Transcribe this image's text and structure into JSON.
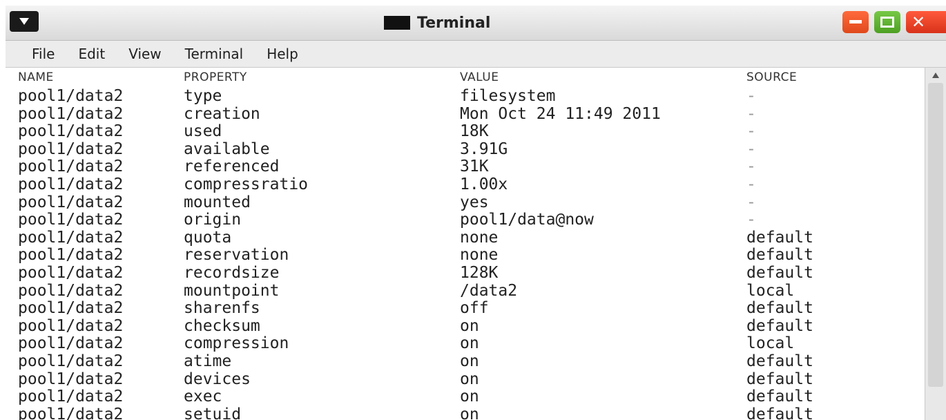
{
  "window": {
    "title": "Terminal"
  },
  "menu": [
    "File",
    "Edit",
    "View",
    "Terminal",
    "Help"
  ],
  "header": {
    "name": "NAME",
    "property": "PROPERTY",
    "value": "VALUE",
    "source": "SOURCE"
  },
  "rows": [
    {
      "name": "pool1/data2",
      "property": "type",
      "value": "filesystem",
      "source": "-"
    },
    {
      "name": "pool1/data2",
      "property": "creation",
      "value": "Mon Oct 24 11:49 2011",
      "source": "-"
    },
    {
      "name": "pool1/data2",
      "property": "used",
      "value": "18K",
      "source": "-"
    },
    {
      "name": "pool1/data2",
      "property": "available",
      "value": "3.91G",
      "source": "-"
    },
    {
      "name": "pool1/data2",
      "property": "referenced",
      "value": "31K",
      "source": "-"
    },
    {
      "name": "pool1/data2",
      "property": "compressratio",
      "value": "1.00x",
      "source": "-"
    },
    {
      "name": "pool1/data2",
      "property": "mounted",
      "value": "yes",
      "source": "-"
    },
    {
      "name": "pool1/data2",
      "property": "origin",
      "value": "pool1/data@now",
      "source": "-"
    },
    {
      "name": "pool1/data2",
      "property": "quota",
      "value": "none",
      "source": "default"
    },
    {
      "name": "pool1/data2",
      "property": "reservation",
      "value": "none",
      "source": "default"
    },
    {
      "name": "pool1/data2",
      "property": "recordsize",
      "value": "128K",
      "source": "default"
    },
    {
      "name": "pool1/data2",
      "property": "mountpoint",
      "value": "/data2",
      "source": "local"
    },
    {
      "name": "pool1/data2",
      "property": "sharenfs",
      "value": "off",
      "source": "default"
    },
    {
      "name": "pool1/data2",
      "property": "checksum",
      "value": "on",
      "source": "default"
    },
    {
      "name": "pool1/data2",
      "property": "compression",
      "value": "on",
      "source": "local"
    },
    {
      "name": "pool1/data2",
      "property": "atime",
      "value": "on",
      "source": "default"
    },
    {
      "name": "pool1/data2",
      "property": "devices",
      "value": "on",
      "source": "default"
    },
    {
      "name": "pool1/data2",
      "property": "exec",
      "value": "on",
      "source": "default"
    },
    {
      "name": "pool1/data2",
      "property": "setuid",
      "value": "on",
      "source": "default"
    }
  ]
}
